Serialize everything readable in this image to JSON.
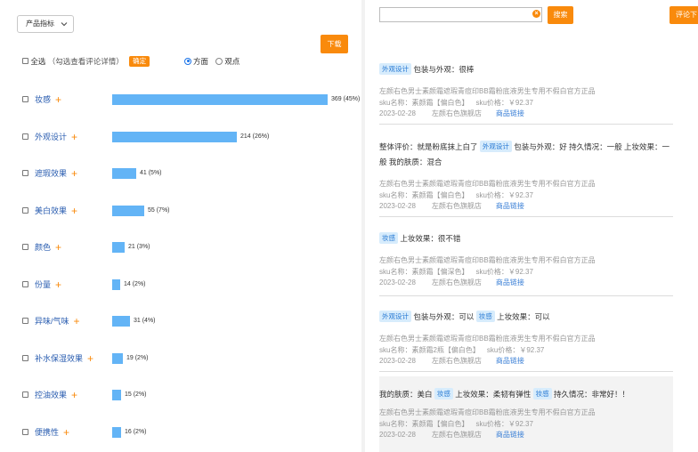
{
  "left_panel": {
    "dropdown_label": "产品指标",
    "download_label": "下载",
    "select_all_label": "全选",
    "select_hint": "（勾选查看评论详情）",
    "confirm_label": "确定",
    "radio_options": [
      {
        "label": "方面",
        "selected": true
      },
      {
        "label": "观点",
        "selected": false
      }
    ],
    "accent_color": "#f98a0c",
    "bar_color": "#63b4f6",
    "items": [
      {
        "name": "妆感",
        "count": 369,
        "share": "369 (45%)"
      },
      {
        "name": "外观设计",
        "count": 214,
        "share": "214 (26%)"
      },
      {
        "name": "遮瑕效果",
        "count": 41,
        "share": "41 (5%)"
      },
      {
        "name": "美白效果",
        "count": 55,
        "share": "55 (7%)"
      },
      {
        "name": "颜色",
        "count": 21,
        "share": "21 (3%)"
      },
      {
        "name": "份量",
        "count": 14,
        "share": "14 (2%)"
      },
      {
        "name": "异味/气味",
        "count": 31,
        "share": "31 (4%)"
      },
      {
        "name": "补水保湿效果",
        "count": 19,
        "share": "19 (2%)"
      },
      {
        "name": "控油效果",
        "count": 15,
        "share": "15 (2%)"
      },
      {
        "name": "便携性",
        "count": 16,
        "share": "16 (2%)"
      }
    ]
  },
  "right_panel": {
    "search_placeholder": "",
    "search_label": "搜索",
    "filter_label": "评论下",
    "reviews": [
      {
        "segments": [
          {
            "tag": true,
            "text": "外观设计"
          },
          {
            "tag": false,
            "text": " 包装与外观：很棒"
          }
        ],
        "product": "左颜右色男士素颜霜遮瑕青痘印BB霜粉底液男生专用不假白官方正品",
        "sku_name": "sku名称：素颜霜【偏白色】",
        "sku_price": "sku价格：￥92.37",
        "date": "2023-02-28",
        "shop": "左颜右色旗舰店",
        "link": "商品链接"
      },
      {
        "segments": [
          {
            "tag": false,
            "text": "整体评价：就是粉底抹上白了 "
          },
          {
            "tag": true,
            "text": "外观设计"
          },
          {
            "tag": false,
            "text": " 包装与外观：好 持久情况：一般 上妆效果：一般 我的肤质：混合"
          }
        ],
        "product": "左颜右色男士素颜霜遮瑕青痘印BB霜粉底液男生专用不假白官方正品",
        "sku_name": "sku名称：素颜霜【偏白色】",
        "sku_price": "sku价格：￥92.37",
        "date": "2023-02-28",
        "shop": "左颜右色旗舰店",
        "link": "商品链接"
      },
      {
        "segments": [
          {
            "tag": true,
            "text": "妆感"
          },
          {
            "tag": false,
            "text": " 上妆效果：很不错"
          }
        ],
        "product": "左颜右色男士素颜霜遮瑕青痘印BB霜粉底液男生专用不假白官方正品",
        "sku_name": "sku名称：素颜霜【偏深色】",
        "sku_price": "sku价格：￥92.37",
        "date": "2023-02-28",
        "shop": "左颜右色旗舰店",
        "link": "商品链接"
      },
      {
        "segments": [
          {
            "tag": true,
            "text": "外观设计"
          },
          {
            "tag": false,
            "text": " 包装与外观：可以 "
          },
          {
            "tag": true,
            "text": "妆感"
          },
          {
            "tag": false,
            "text": " 上妆效果：可以"
          }
        ],
        "product": "左颜右色男士素颜霜遮瑕青痘印BB霜粉底液男生专用不假白官方正品",
        "sku_name": "sku名称：素颜霜2瓶【偏白色】",
        "sku_price": "sku价格：￥92.37",
        "date": "2023-02-28",
        "shop": "左颜右色旗舰店",
        "link": "商品链接"
      },
      {
        "segments": [
          {
            "tag": false,
            "text": "我的肤质：美白 "
          },
          {
            "tag": true,
            "text": "妆感"
          },
          {
            "tag": false,
            "text": " 上妆效果：柔韧有弹性 "
          },
          {
            "tag": true,
            "text": "妆感"
          },
          {
            "tag": false,
            "text": " 持久情况：非常好！！"
          }
        ],
        "product": "左颜右色男士素颜霜遮瑕青痘印BB霜粉底液男生专用不假白官方正品",
        "sku_name": "sku名称：素颜霜【偏白色】",
        "sku_price": "sku价格：￥92.37",
        "date": "2023-02-28",
        "shop": "左颜右色旗舰店",
        "link": "商品链接"
      }
    ]
  }
}
